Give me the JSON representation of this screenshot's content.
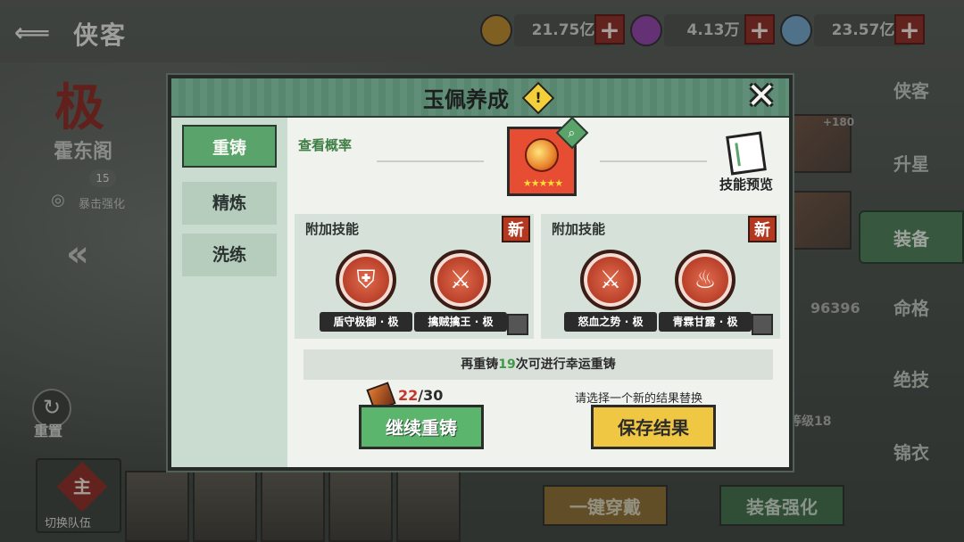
{
  "screen": {
    "title": "侠客",
    "back_icon": "wing-back-icon"
  },
  "resources": [
    {
      "value": "21.75亿",
      "icon": "coin-icon",
      "color": "#b8862a"
    },
    {
      "value": "4.13万",
      "icon": "purple-orb-icon",
      "color": "#8e3fa8"
    },
    {
      "value": "23.57亿",
      "icon": "blue-orb-icon",
      "color": "#6fa3c9"
    }
  ],
  "right_nav": [
    "侠客",
    "升星",
    "装备",
    "命格",
    "绝技",
    "锦衣"
  ],
  "right_nav_active": "装备",
  "hero": {
    "grade": "极",
    "name": "霍东阁",
    "level": "15",
    "buff": "暴击强化"
  },
  "reset_label": "重置",
  "team": {
    "switch_label": "切换队伍",
    "switch_icon_text": "主"
  },
  "background_stats": {
    "power": "96396",
    "level": "等级18",
    "card_bonus": "+180"
  },
  "bottom_buttons": {
    "equip_all": "一键穿戴",
    "enhance": "装备强化"
  },
  "modal": {
    "title": "玉佩养成",
    "tabs": [
      "重铸",
      "精炼",
      "洗练"
    ],
    "active_tab": "重铸",
    "view_probability": "查看概率",
    "item_stars": "★★★★★",
    "skill_preview": "技能预览",
    "panels": [
      {
        "title": "附加技能",
        "badge": "新",
        "skills": [
          {
            "name": "盾守极御 · 极",
            "icon": "shield-icon"
          },
          {
            "name": "擒贼擒王 · 极",
            "icon": "sword-icon"
          }
        ]
      },
      {
        "title": "附加技能",
        "badge": "新",
        "skills": [
          {
            "name": "怒血之势 · 极",
            "icon": "sword-up-icon"
          },
          {
            "name": "青霖甘露 · 极",
            "icon": "gourd-icon"
          }
        ]
      }
    ],
    "luck": {
      "prefix": "再重铸",
      "count": "19",
      "suffix": "次可进行幸运重铸"
    },
    "material": {
      "current": "22",
      "total": "/30"
    },
    "hint": "请选择一个新的结果替换",
    "continue_button": "继续重铸",
    "save_button": "保存结果"
  }
}
